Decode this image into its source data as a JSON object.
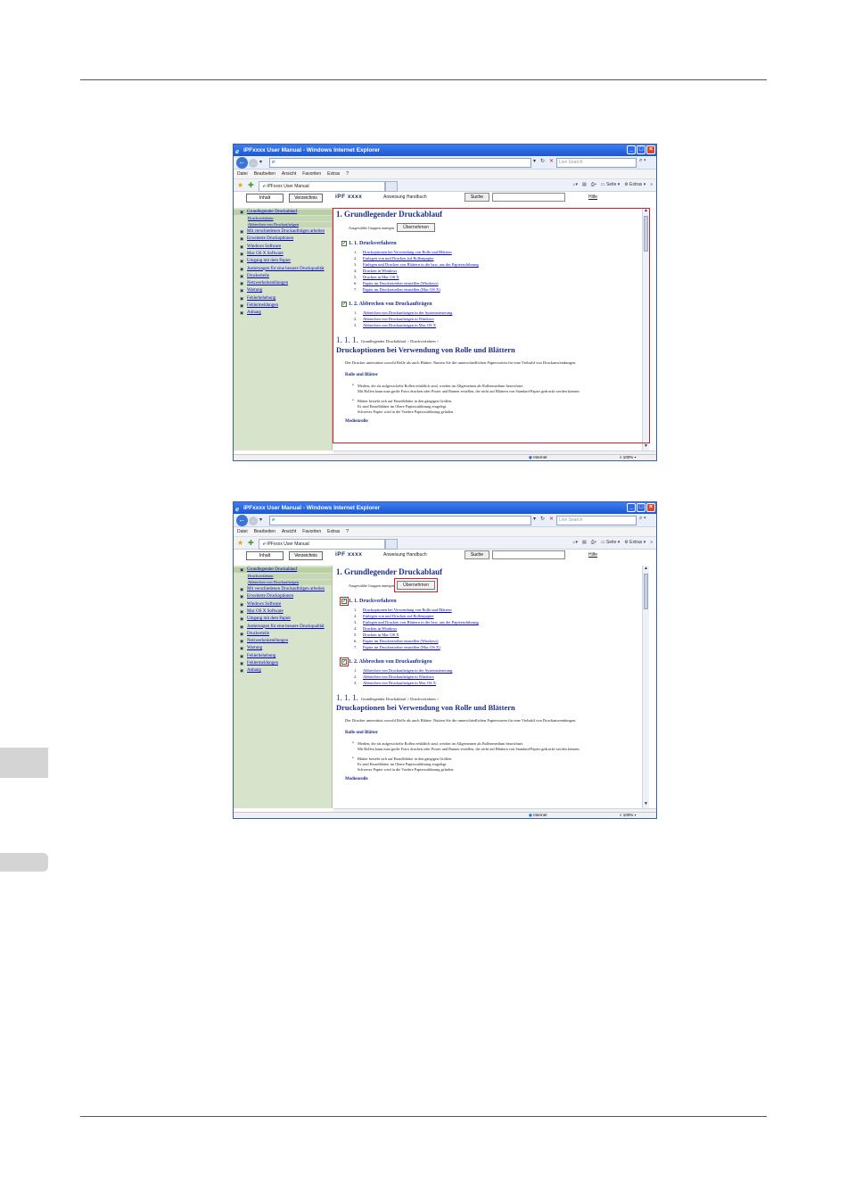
{
  "browser": {
    "window_title": "iPFxxxx User Manual - Windows Internet Explorer",
    "address": "",
    "live_search_placeholder": "Live Search",
    "menu": [
      "Datei",
      "Bearbeiten",
      "Ansicht",
      "Favoriten",
      "Extras",
      "?"
    ],
    "tab_title": "iPFxxxx User Manual",
    "cmd_page": "Seite",
    "cmd_extras": "Extras",
    "cmd_more": "»",
    "status_zone": "Internet",
    "status_zoom": "100%"
  },
  "app": {
    "tab_contents": "Inhalt",
    "tab_index": "Verzeichnis",
    "brand": "iPF xxxx",
    "brand_sub": "Anweisung Handbuch",
    "search_button": "Suche",
    "help_link": "Hilfe"
  },
  "sidebar": {
    "items": [
      {
        "label": "Grundlegender Druckablauf",
        "subs": [
          "Druckverfahren",
          "Abbrechen von Druckaufträgen"
        ]
      },
      {
        "label": "Mit verschiedenen Druckaufträgen arbeiten"
      },
      {
        "label": "Erweiterte Druckoptionen"
      },
      {
        "label": "Windows Software"
      },
      {
        "label": "Mac OS X Software"
      },
      {
        "label": "Umgang mit dem Papier"
      },
      {
        "label": "Justierungen für eine bessere Druckqualität"
      },
      {
        "label": "Druckerteile"
      },
      {
        "label": "Netzwerkeinstellungen"
      },
      {
        "label": "Wartung"
      },
      {
        "label": "Fehlerbehebung"
      },
      {
        "label": "Fehlermeldungen"
      },
      {
        "label": "Anhang"
      }
    ]
  },
  "content": {
    "h1": "1. Grundlegender Druckablauf",
    "group_label": "Ausgewählte Gruppen anzeigen",
    "apply_button": "Übernehmen",
    "sections": [
      {
        "title": "1. 1. Druckverfahren",
        "items": [
          "Druckoptionen bei Verwendung von Rolle und Blättern",
          "Einlegen von und Drucken auf Rollenpapier",
          "Einlegen und Drucken von Blättern in die bzw. aus der Papierzuführung",
          "Drucken in Windows",
          "Drucken in Mac OS X",
          "Papier im Druckertreiber einstellen (Windows)",
          "Papier im Druckertreiber einstellen (Mac OS X)"
        ]
      },
      {
        "title": "1. 2. Abbrechen von Druckaufträgen",
        "items": [
          "Abbrechen von Druckaufträgen in der Systemsteuerung",
          "Abbrechen von Druckaufträgen in Windows",
          "Abbrechen von Druckaufträgen in Mac OS X"
        ]
      }
    ],
    "crumb_num": "1. 1. 1.",
    "crumb_text": "Grundlegender Druckablauf > Druckverfahren >",
    "h2": "Druckoptionen bei Verwendung von Rolle und Blättern",
    "intro": "Der Drucker unterstützt sowohl Rolle als auch Blätter. Nutzen Sie die unterschiedlichen Papiersorten für eine Vielzahl von Druckanwendungen.",
    "h3": "Rolle und Blätter",
    "bullets": [
      [
        "Medien, die als aufgewickelte Rollen erhältlich sind, werden im Allgemeinen als Rollenmedium bezeichnet.",
        "Mit Rollen kann man große Fotos drucken oder Poster und Banner erstellen, die nicht auf Blättern von Standard-Papier gedruckt werden können."
      ],
      [
        "Blätter besteht sich auf Einzelblätter in den gängigen Größen.",
        "Es sind Einzelblätter im Obere Papierzuführung eingelegt.",
        "Schweres Papier wird in die Vordere Papierzuführung geladen."
      ]
    ],
    "h3b": "Medienrolle"
  }
}
